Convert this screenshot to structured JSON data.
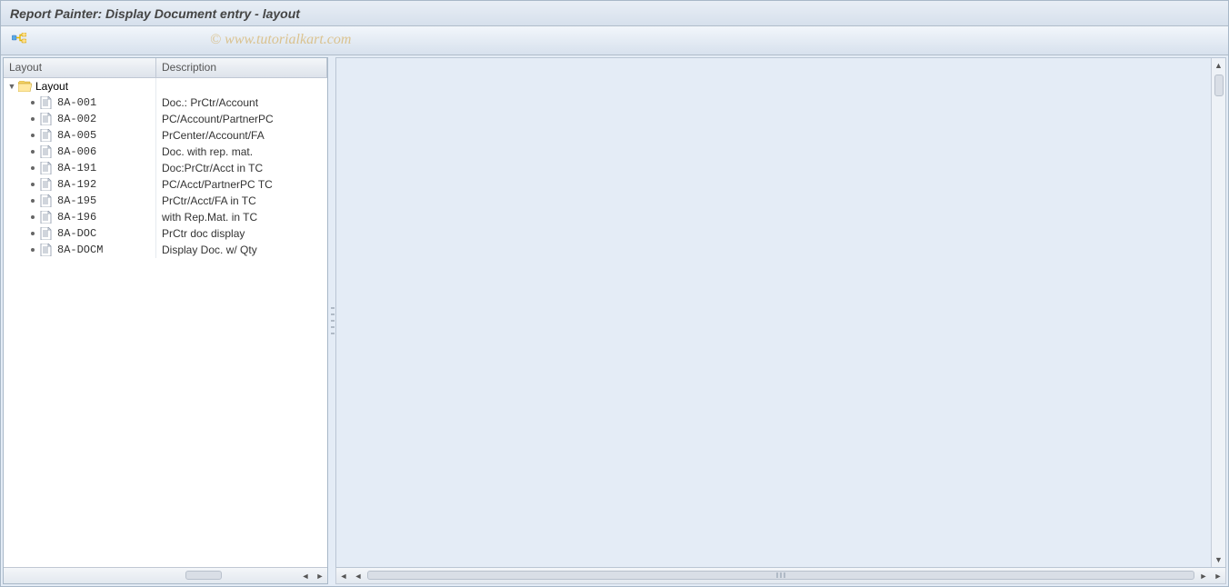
{
  "title": "Report Painter: Display Document entry - layout",
  "watermark": "© www.tutorialkart.com",
  "tree": {
    "columns": {
      "layout": "Layout",
      "description": "Description"
    },
    "root_label": "Layout",
    "items": [
      {
        "code": "8A-001",
        "desc": "Doc.: PrCtr/Account"
      },
      {
        "code": "8A-002",
        "desc": "PC/Account/PartnerPC"
      },
      {
        "code": "8A-005",
        "desc": "PrCenter/Account/FA"
      },
      {
        "code": "8A-006",
        "desc": "Doc. with rep. mat."
      },
      {
        "code": "8A-191",
        "desc": "Doc:PrCtr/Acct in TC"
      },
      {
        "code": "8A-192",
        "desc": "PC/Acct/PartnerPC TC"
      },
      {
        "code": "8A-195",
        "desc": "PrCtr/Acct/FA in TC"
      },
      {
        "code": "8A-196",
        "desc": "with Rep.Mat. in TC"
      },
      {
        "code": "8A-DOC",
        "desc": "PrCtr doc display"
      },
      {
        "code": "8A-DOCM",
        "desc": "Display Doc. w/ Qty"
      }
    ]
  }
}
